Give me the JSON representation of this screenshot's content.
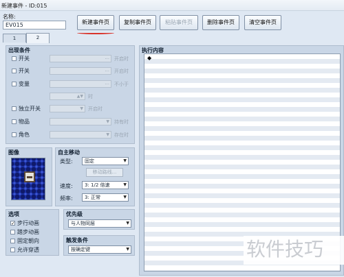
{
  "window": {
    "title": "新建事件 - ID:015"
  },
  "name_label": "名称:",
  "name_value": "EV015",
  "toolbar": {
    "new": "新建事件页",
    "copy": "复制事件页",
    "paste": "粘贴事件页",
    "delete": "删除事件页",
    "clear": "清空事件页"
  },
  "page_tabs": [
    "1",
    "2"
  ],
  "conditions": {
    "title": "出现条件",
    "switch1": "开关",
    "switch2": "开关",
    "variable": "变量",
    "self_switch": "独立开关",
    "item": "物品",
    "actor": "角色",
    "on_text": "开启时",
    "not_less": "不小于",
    "times": "时",
    "self_on": "开启时",
    "held": "持有时",
    "present": "存在时"
  },
  "image": {
    "title": "图像"
  },
  "movement": {
    "title": "自主移动",
    "type_label": "类型:",
    "type_value": "固定",
    "route_button": "移动路线...",
    "speed_label": "速度:",
    "speed_value": "3: 1/2 倍速",
    "freq_label": "频率:",
    "freq_value": "3: 正常"
  },
  "options": {
    "title": "选项",
    "walking": "步行动画",
    "stepping": "踏步动画",
    "direction_fix": "固定朝向",
    "through": "允许穿透",
    "walking_checked": true
  },
  "priority": {
    "title": "优先级",
    "value": "与人物同层"
  },
  "trigger": {
    "title": "触发条件",
    "value": "按确定键"
  },
  "exec": {
    "title": "执行内容",
    "row": "◆"
  },
  "watermark": "软件技巧"
}
